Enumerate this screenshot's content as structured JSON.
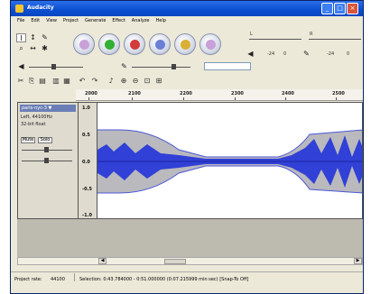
{
  "window": {
    "title": "Audacity"
  },
  "menubar": {
    "items": [
      "File",
      "Edit",
      "View",
      "Project",
      "Generate",
      "Effect",
      "Analyze",
      "Help"
    ]
  },
  "toolbar": {
    "tools": [
      {
        "name": "selection-tool",
        "glyph": "I"
      },
      {
        "name": "envelope-tool",
        "glyph": "↕"
      },
      {
        "name": "draw-tool",
        "glyph": "✎"
      },
      {
        "name": "zoom-tool",
        "glyph": "🔍"
      },
      {
        "name": "timeshift-tool",
        "glyph": "↔"
      },
      {
        "name": "multi-tool",
        "glyph": "✱"
      }
    ],
    "transport": [
      {
        "name": "skip-to-start-button",
        "color": "#c9a0d8"
      },
      {
        "name": "play-button",
        "color": "#33b033"
      },
      {
        "name": "record-button",
        "color": "#d33b3b"
      },
      {
        "name": "pause-button",
        "color": "#6a7fd6"
      },
      {
        "name": "stop-button",
        "color": "#d9b034"
      },
      {
        "name": "skip-to-end-button",
        "color": "#c9a0d8"
      }
    ],
    "meter_ticks": [
      "-24",
      "0",
      "-24",
      "0"
    ],
    "mixer_labels": [
      "L",
      "R"
    ]
  },
  "editbar": {
    "icons": [
      "cut",
      "copy",
      "paste",
      "trim",
      "silence",
      "undo",
      "redo",
      "sync",
      "zoom-in",
      "zoom-out",
      "fit",
      "zoom-toggle"
    ]
  },
  "ruler": {
    "ticks": [
      "2000",
      "2100",
      "2200",
      "2300",
      "2400",
      "2500"
    ]
  },
  "track": {
    "name": "paris-nyc-3 ▼",
    "format_line1": "Left, 44100Hz",
    "format_line2": "32-bit float",
    "mute": "Mute",
    "solo": "Solo",
    "scale": [
      "1.0",
      "0.5",
      "0.0",
      "-0.5",
      "-1.0"
    ]
  },
  "status": {
    "project_rate_label": "Project rate:",
    "project_rate_value": "44100",
    "selection_text": "Selection: 0:43.784000 - 0:51.000000 (0:07.215999 min:sec)  [Snap-To Off]"
  }
}
